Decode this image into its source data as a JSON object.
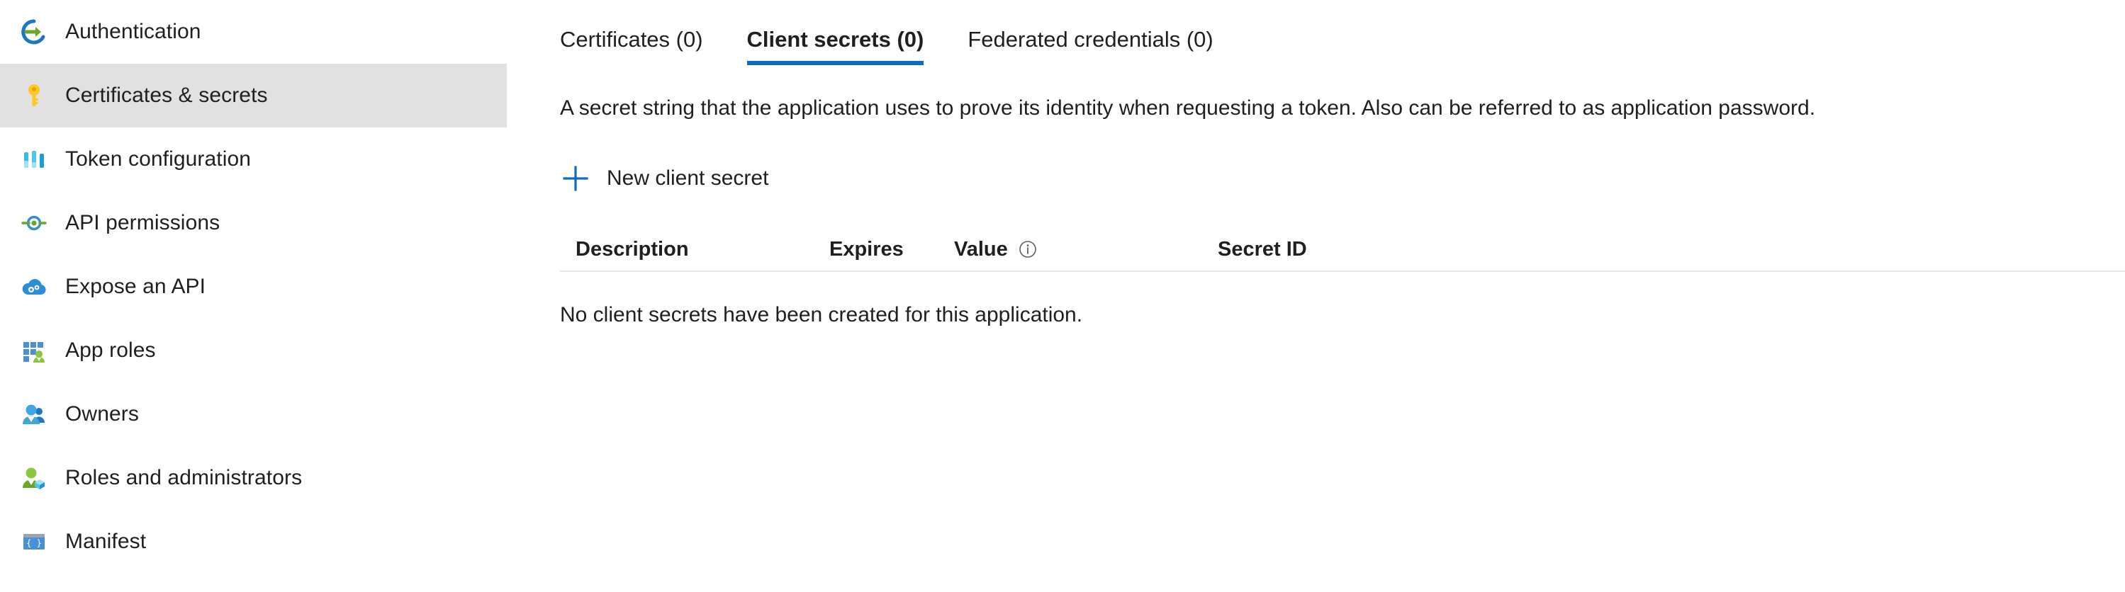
{
  "sidebar": {
    "items": [
      {
        "label": "Authentication",
        "icon": "authentication-icon",
        "selected": false
      },
      {
        "label": "Certificates & secrets",
        "icon": "key-icon",
        "selected": true
      },
      {
        "label": "Token configuration",
        "icon": "token-configuration-icon",
        "selected": false
      },
      {
        "label": "API permissions",
        "icon": "api-permissions-icon",
        "selected": false
      },
      {
        "label": "Expose an API",
        "icon": "cloud-gears-icon",
        "selected": false
      },
      {
        "label": "App roles",
        "icon": "app-roles-icon",
        "selected": false
      },
      {
        "label": "Owners",
        "icon": "owners-icon",
        "selected": false
      },
      {
        "label": "Roles and administrators",
        "icon": "roles-administrators-icon",
        "selected": false
      },
      {
        "label": "Manifest",
        "icon": "manifest-icon",
        "selected": false
      }
    ],
    "selected_bg": "#e1e1e1"
  },
  "main": {
    "tabs": [
      {
        "label": "Certificates (0)",
        "active": false
      },
      {
        "label": "Client secrets (0)",
        "active": true
      },
      {
        "label": "Federated credentials (0)",
        "active": false
      }
    ],
    "accent_color": "#0f6cbd",
    "description": "A secret string that the application uses to prove its identity when requesting a token. Also can be referred to as application password.",
    "command_bar": {
      "new_secret_label": "New client secret",
      "new_secret_icon": "plus-icon"
    },
    "table": {
      "columns": [
        {
          "key": "description",
          "label": "Description",
          "info": false
        },
        {
          "key": "expires",
          "label": "Expires",
          "info": false
        },
        {
          "key": "value",
          "label": "Value",
          "info": true
        },
        {
          "key": "secret_id",
          "label": "Secret ID",
          "info": false
        }
      ],
      "rows": [],
      "empty_message": "No client secrets have been created for this application."
    }
  }
}
